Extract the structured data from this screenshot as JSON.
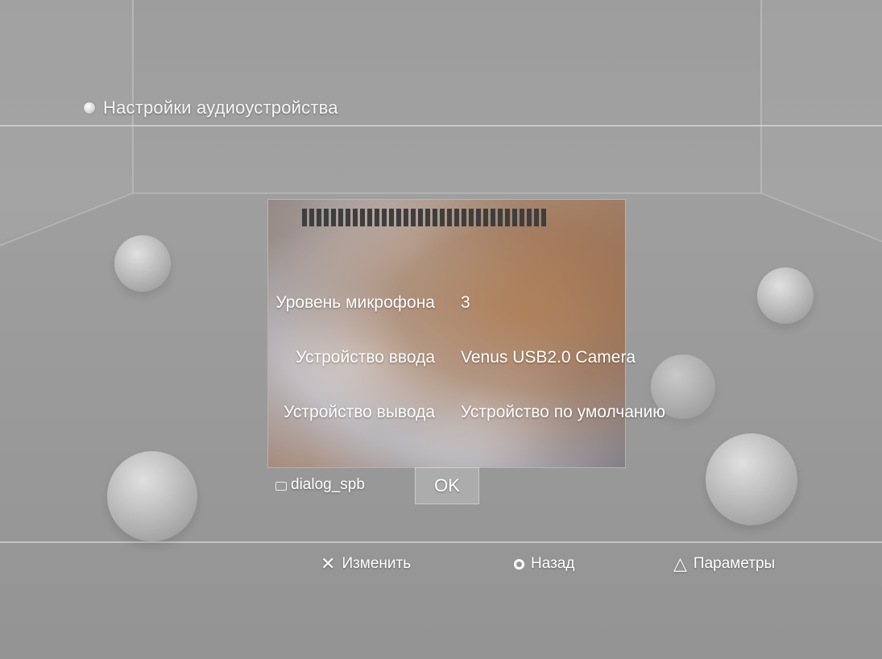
{
  "header": {
    "title": "Настройки аудиоустройства",
    "title_icon": "bullet-dot-icon"
  },
  "preview": {
    "meter_segments": 34,
    "meter_icon": "level-meter-icon"
  },
  "settings": [
    {
      "label": "Уровень микрофона",
      "value": "3"
    },
    {
      "label": "Устройство ввода",
      "value": "Venus USB2.0 Camera"
    },
    {
      "label": "Устройство вывода",
      "value": "Устройство по умолчанию"
    }
  ],
  "dialog": {
    "label": "dialog_spb",
    "ok_label": "OK"
  },
  "footer": {
    "change": {
      "glyph": "✕",
      "label": "Изменить",
      "icon": "cross-button-icon"
    },
    "back": {
      "glyph": "○",
      "label": "Назад",
      "icon": "circle-button-icon"
    },
    "options": {
      "glyph": "△",
      "label": "Параметры",
      "icon": "triangle-button-icon"
    }
  },
  "colors": {
    "background": "#9d9d9d",
    "text": "#ffffff",
    "meter": "#3e3e3e"
  }
}
